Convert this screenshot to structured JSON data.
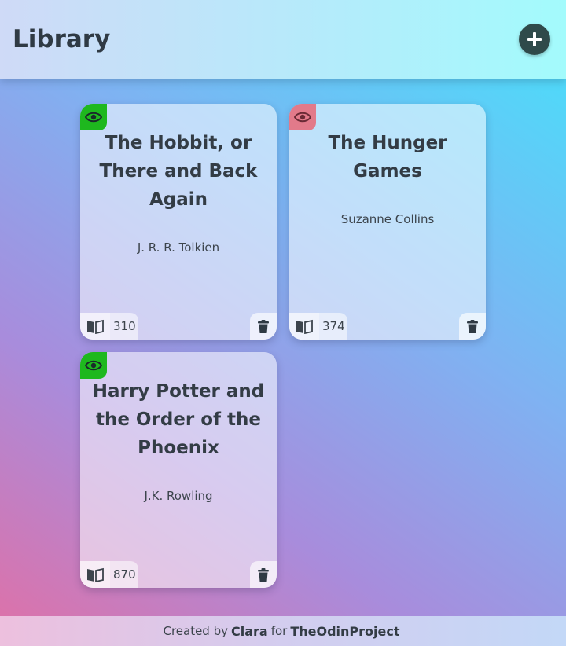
{
  "header": {
    "title": "Library",
    "add_button_icon": "plus-icon"
  },
  "books": [
    {
      "title": "The Hobbit, or There and Back Again",
      "author": "J. R. R. Tolkien",
      "pages": "310",
      "read": true
    },
    {
      "title": "The Hunger Games",
      "author": "Suzanne Collins",
      "pages": "374",
      "read": false
    },
    {
      "title": "Harry Potter and the Order of the Phoenix",
      "author": "J.K. Rowling",
      "pages": "870",
      "read": true
    }
  ],
  "footer": {
    "created_by": "Created by",
    "author": "Clara",
    "for": "for",
    "org": "TheOdinProject"
  },
  "colors": {
    "read": "#1eb81e",
    "unread": "#e27a8a",
    "dark": "#2f4a4a"
  }
}
